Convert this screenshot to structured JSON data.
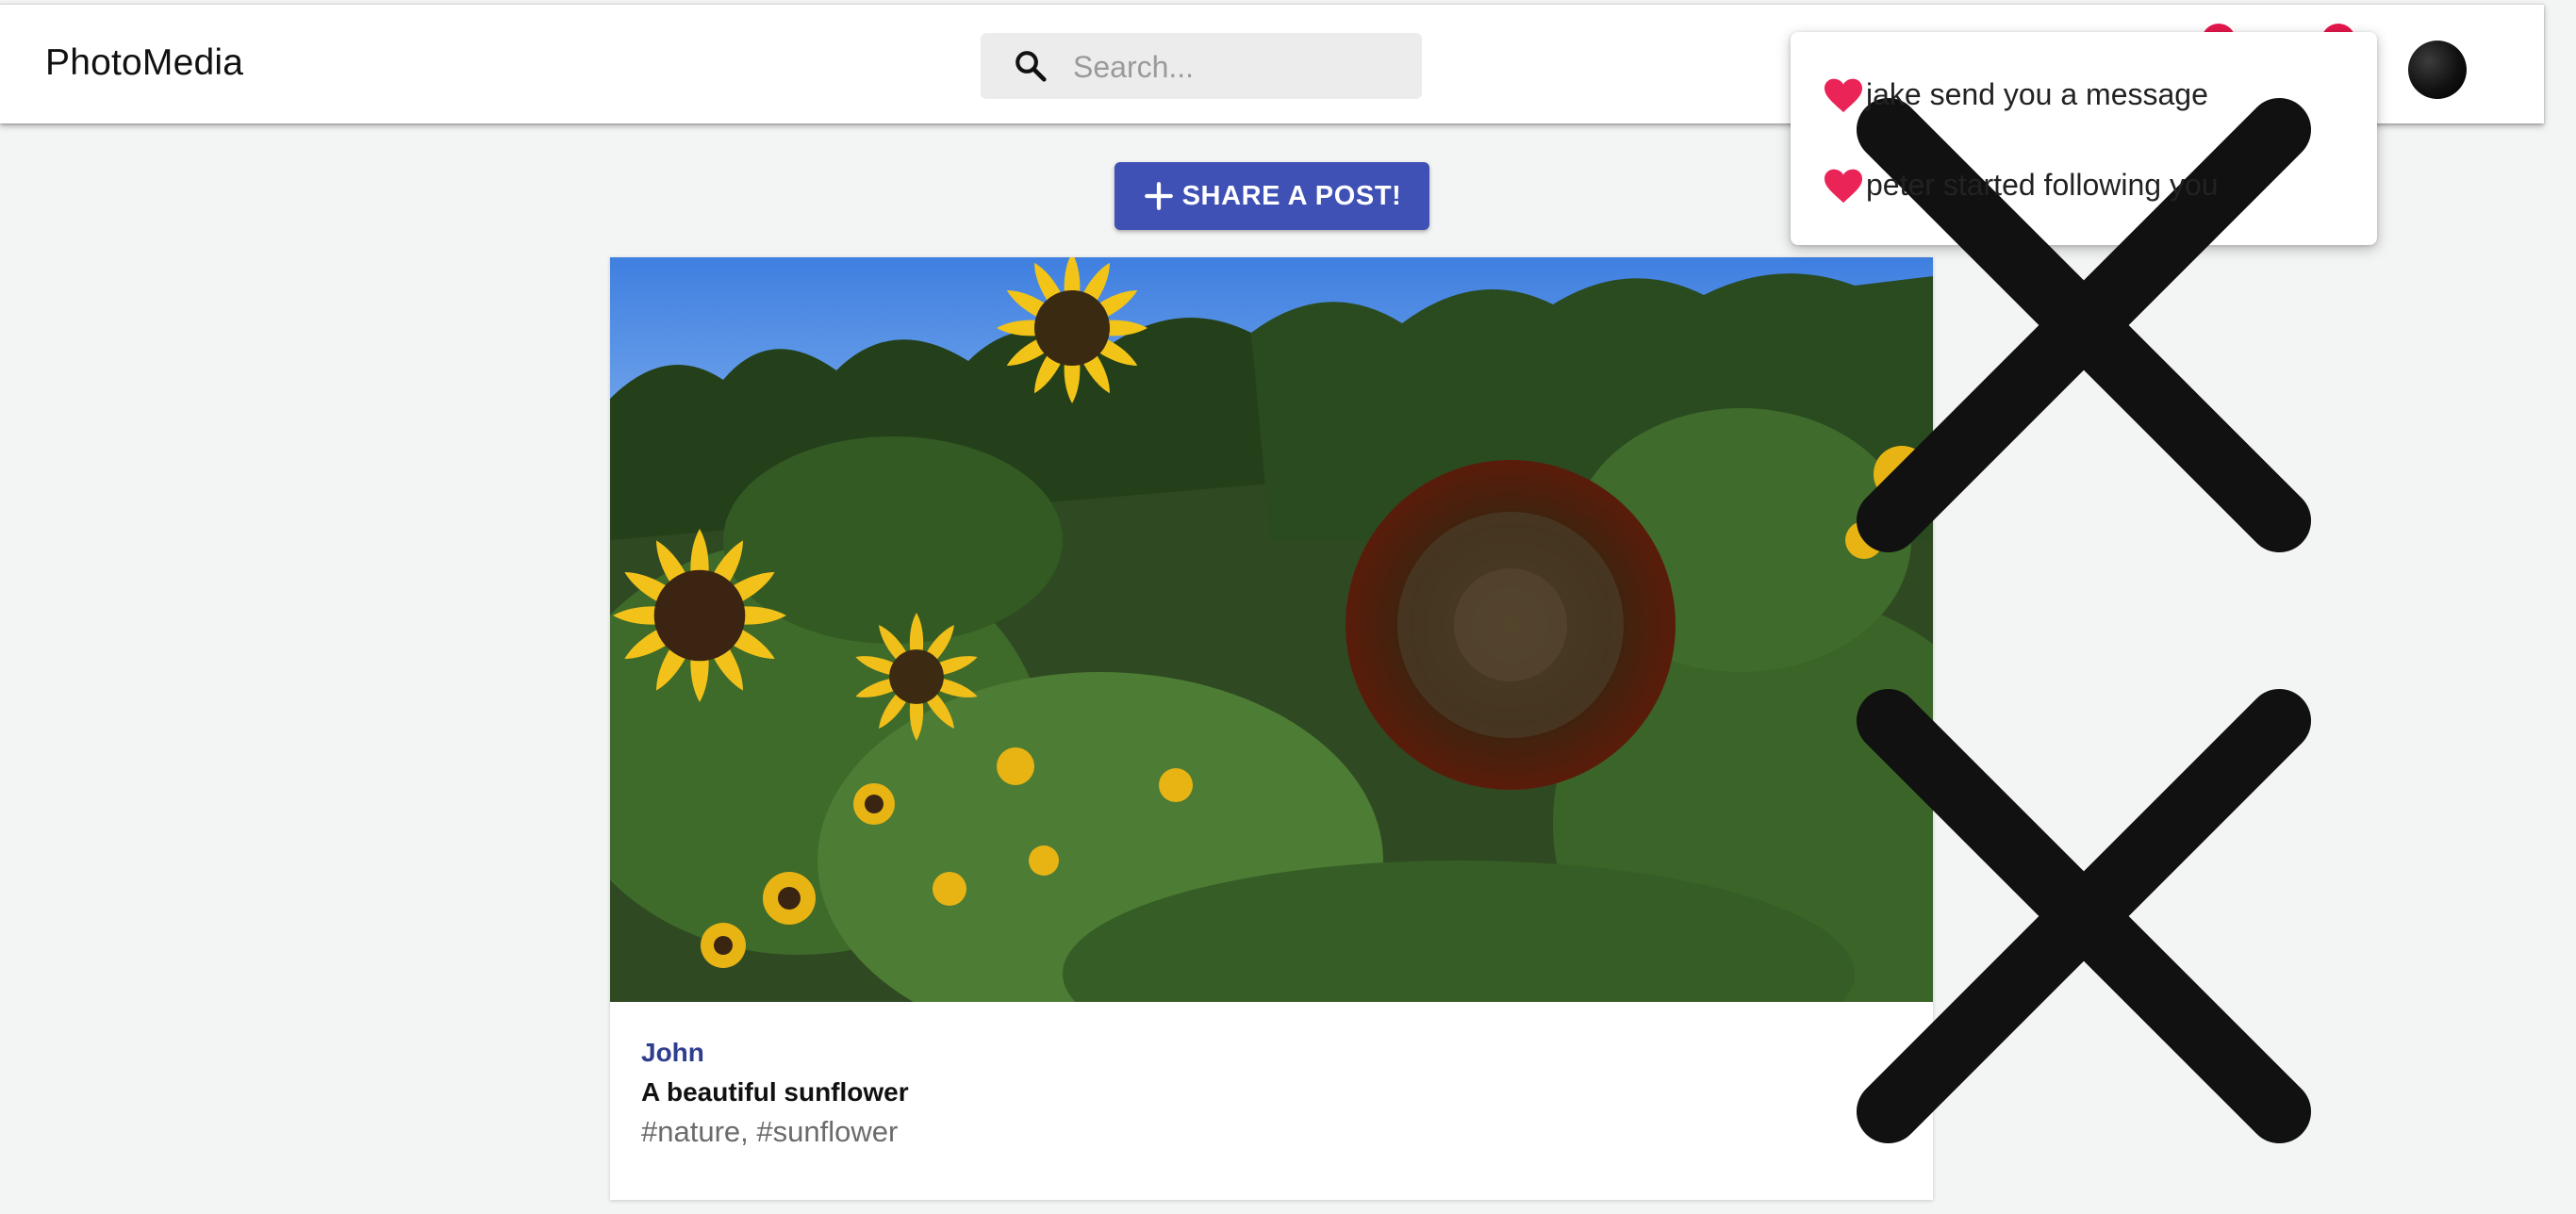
{
  "app": {
    "title": "PhotoMedia"
  },
  "search": {
    "placeholder": "Search..."
  },
  "notifications": [
    {
      "text": "jake send you a message",
      "icon": "heart-icon"
    },
    {
      "text": "peter started following you",
      "icon": "heart-icon"
    }
  ],
  "share": {
    "label": "SHARE A POST!",
    "icon": "plus-icon"
  },
  "post": {
    "author": "John",
    "caption": "A beautiful sunflower",
    "tags": "#nature, #sunflower",
    "image": "sunflower-photo"
  },
  "colors": {
    "primary": "#3f51b5",
    "badge": "#e5174d",
    "heart": "#ea2457",
    "background": "#f3f4f4"
  }
}
